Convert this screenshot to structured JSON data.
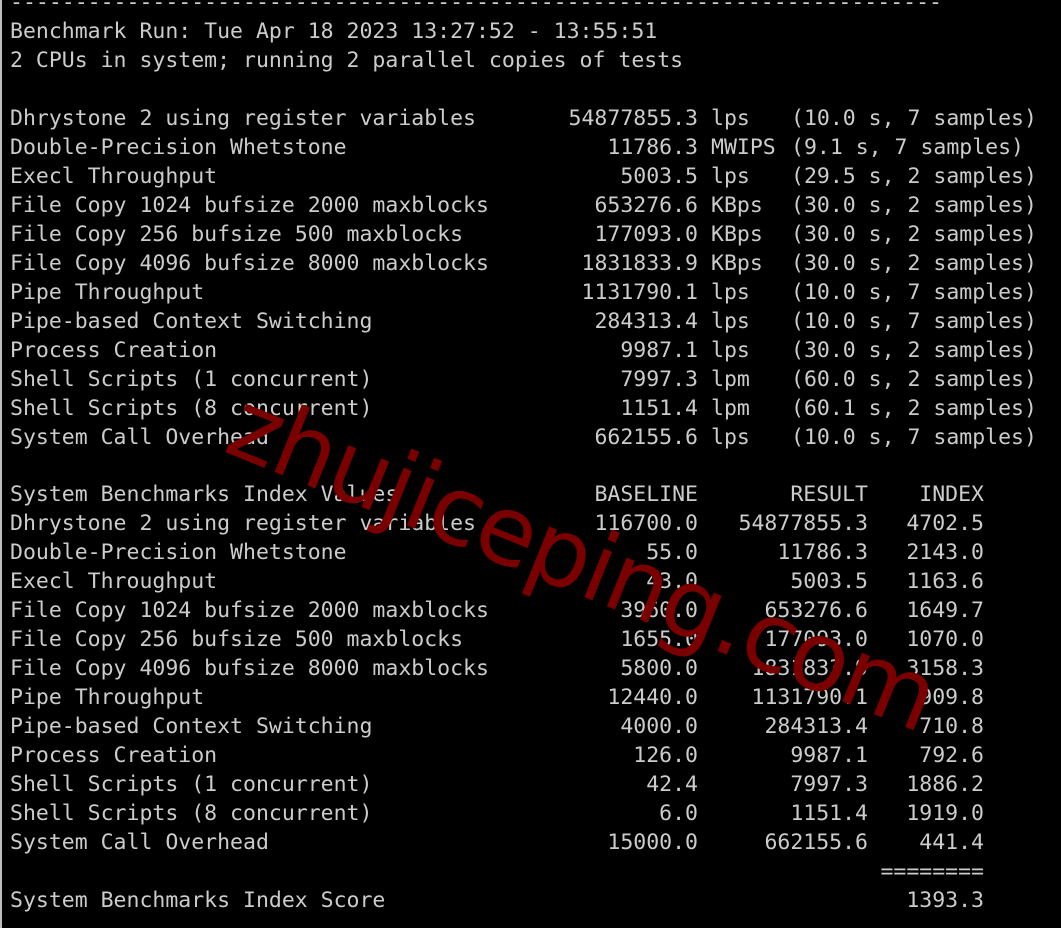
{
  "terminal": {
    "separator": "------------------------------------------------------------------------",
    "run_line": "Benchmark Run: Tue Apr 18 2023 13:27:52 - 13:55:51",
    "cpu_line": "2 CPUs in system; running 2 parallel copies of tests",
    "results": [
      {
        "name": "Dhrystone 2 using register variables",
        "value": "54877855.3",
        "unit": "lps",
        "detail": "(10.0 s, 7 samples)"
      },
      {
        "name": "Double-Precision Whetstone",
        "value": "11786.3",
        "unit": "MWIPS",
        "detail": "(9.1 s, 7 samples)"
      },
      {
        "name": "Execl Throughput",
        "value": "5003.5",
        "unit": "lps",
        "detail": "(29.5 s, 2 samples)"
      },
      {
        "name": "File Copy 1024 bufsize 2000 maxblocks",
        "value": "653276.6",
        "unit": "KBps",
        "detail": "(30.0 s, 2 samples)"
      },
      {
        "name": "File Copy 256 bufsize 500 maxblocks",
        "value": "177093.0",
        "unit": "KBps",
        "detail": "(30.0 s, 2 samples)"
      },
      {
        "name": "File Copy 4096 bufsize 8000 maxblocks",
        "value": "1831833.9",
        "unit": "KBps",
        "detail": "(30.0 s, 2 samples)"
      },
      {
        "name": "Pipe Throughput",
        "value": "1131790.1",
        "unit": "lps",
        "detail": "(10.0 s, 7 samples)"
      },
      {
        "name": "Pipe-based Context Switching",
        "value": "284313.4",
        "unit": "lps",
        "detail": "(10.0 s, 7 samples)"
      },
      {
        "name": "Process Creation",
        "value": "9987.1",
        "unit": "lps",
        "detail": "(30.0 s, 2 samples)"
      },
      {
        "name": "Shell Scripts (1 concurrent)",
        "value": "7997.3",
        "unit": "lpm",
        "detail": "(60.0 s, 2 samples)"
      },
      {
        "name": "Shell Scripts (8 concurrent)",
        "value": "1151.4",
        "unit": "lpm",
        "detail": "(60.1 s, 2 samples)"
      },
      {
        "name": "System Call Overhead",
        "value": "662155.6",
        "unit": "lps",
        "detail": "(10.0 s, 7 samples)"
      }
    ],
    "index": {
      "title": "System Benchmarks Index Values",
      "col_baseline": "BASELINE",
      "col_result": "RESULT",
      "col_index": "INDEX",
      "rows": [
        {
          "name": "Dhrystone 2 using register variables",
          "baseline": "116700.0",
          "result": "54877855.3",
          "index": "4702.5"
        },
        {
          "name": "Double-Precision Whetstone",
          "baseline": "55.0",
          "result": "11786.3",
          "index": "2143.0"
        },
        {
          "name": "Execl Throughput",
          "baseline": "43.0",
          "result": "5003.5",
          "index": "1163.6"
        },
        {
          "name": "File Copy 1024 bufsize 2000 maxblocks",
          "baseline": "3960.0",
          "result": "653276.6",
          "index": "1649.7"
        },
        {
          "name": "File Copy 256 bufsize 500 maxblocks",
          "baseline": "1655.0",
          "result": "177093.0",
          "index": "1070.0"
        },
        {
          "name": "File Copy 4096 bufsize 8000 maxblocks",
          "baseline": "5800.0",
          "result": "1831833.9",
          "index": "3158.3"
        },
        {
          "name": "Pipe Throughput",
          "baseline": "12440.0",
          "result": "1131790.1",
          "index": "909.8"
        },
        {
          "name": "Pipe-based Context Switching",
          "baseline": "4000.0",
          "result": "284313.4",
          "index": "710.8"
        },
        {
          "name": "Process Creation",
          "baseline": "126.0",
          "result": "9987.1",
          "index": "792.6"
        },
        {
          "name": "Shell Scripts (1 concurrent)",
          "baseline": "42.4",
          "result": "7997.3",
          "index": "1886.2"
        },
        {
          "name": "Shell Scripts (8 concurrent)",
          "baseline": "6.0",
          "result": "1151.4",
          "index": "1919.0"
        },
        {
          "name": "System Call Overhead",
          "baseline": "15000.0",
          "result": "662155.6",
          "index": "441.4"
        }
      ],
      "rule": "========",
      "score_label": "System Benchmarks Index Score",
      "score_value": "1393.3"
    },
    "watermark": "zhujiceping.com"
  }
}
